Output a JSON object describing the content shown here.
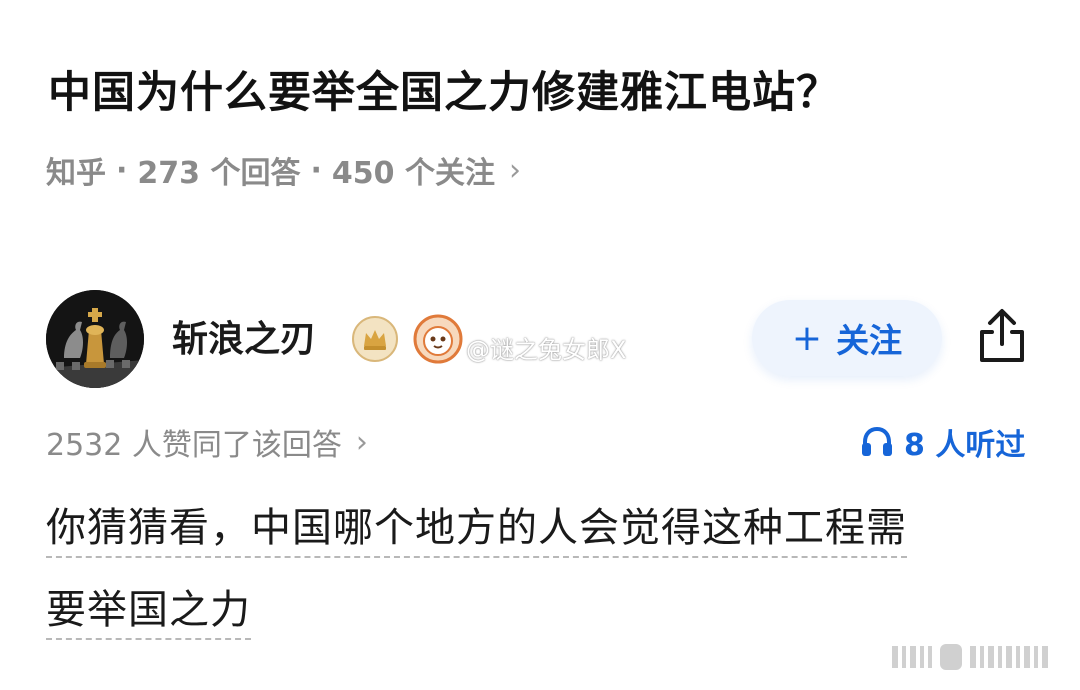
{
  "question": {
    "title": "中国为什么要举全国之力修建雅江电站？",
    "source": "知乎",
    "answers": "273 个回答",
    "followers": "450 个关注",
    "chevron": "›"
  },
  "author": {
    "name": "斩浪之刃",
    "watermark": "@谜之兔女郎X",
    "follow_label": "关注",
    "follow_icon": "+"
  },
  "stats": {
    "likes": "2532 人赞同了该回答",
    "chevron": "›",
    "listeners": "8 人听过"
  },
  "answer": {
    "line1": "你猜猜看，中国哪个地方的人会觉得这种工程需",
    "line2": "要举国之力"
  },
  "colors": {
    "accent": "#1665d8",
    "meta": "#8a8a8a",
    "follow_bg": "#eef4fd"
  },
  "icons": {
    "avatar": "chess-king-avatar",
    "badge1": "crown-badge-icon",
    "badge2": "mascot-badge-icon",
    "share": "share-icon",
    "listen": "headphones-icon"
  }
}
